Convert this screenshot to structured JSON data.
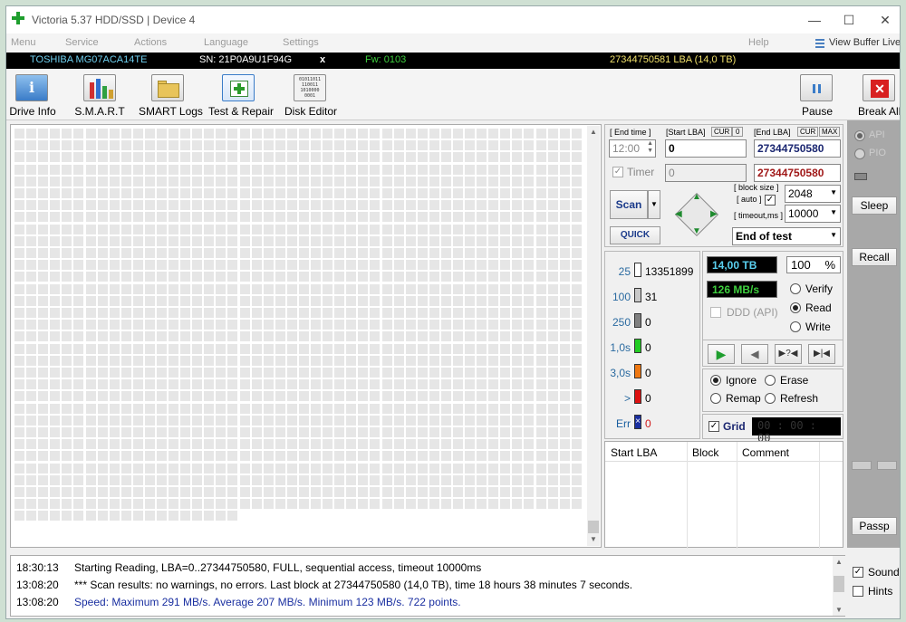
{
  "window": {
    "title": "Victoria 5.37 HDD/SSD | Device 4",
    "minimize": "—",
    "maximize": "☐",
    "close": "✕"
  },
  "menu": {
    "items": [
      "Menu",
      "Service",
      "Actions",
      "Language",
      "Settings"
    ],
    "help": "Help",
    "view_buffer": "View Buffer Live"
  },
  "drive": {
    "model": "TOSHIBA MG07ACA14TE",
    "serial": "SN: 21P0A9U1F94G",
    "x": "x",
    "fw": "Fw: 0103",
    "capacity": "27344750581 LBA (14,0 TB)"
  },
  "toolbar": {
    "drive_info": "Drive Info",
    "smart": "S.M.A.R.T",
    "smart_logs": "SMART Logs",
    "test_repair": "Test & Repair",
    "disk_editor": "Disk Editor",
    "pause": "Pause",
    "break_all": "Break All",
    "disk_editor_icon_text": "01011011\n110011\n1010000\n0001"
  },
  "scan_panel": {
    "end_time_label": "[ End time ]",
    "end_time_value": "12:00",
    "start_lba_label": "[Start LBA]",
    "cur": "CUR",
    "zero": "0",
    "start_lba_value": "0",
    "end_lba_label": "[End LBA]",
    "max": "MAX",
    "end_lba_value": "27344750580",
    "timer_label": "Timer",
    "timer_value": "0",
    "end_lba_value2": "27344750580",
    "scan_button": "Scan",
    "quick_button": "QUICK",
    "block_size_label": "[ block size ]",
    "auto_label": "[ auto ]",
    "block_size_value": "2048",
    "timeout_label": "[ timeout,ms ]",
    "timeout_value": "10000",
    "end_of_test": "End of test"
  },
  "stats": {
    "rows": [
      {
        "label": "25",
        "value": "13351899",
        "color": "#ffffff"
      },
      {
        "label": "100",
        "value": "31",
        "color": "#c8c8c8"
      },
      {
        "label": "250",
        "value": "0",
        "color": "#808080"
      },
      {
        "label": "1,0s",
        "value": "0",
        "color": "#22cc22"
      },
      {
        "label": "3,0s",
        "value": "0",
        "color": "#ee7711"
      },
      {
        "label": ">",
        "value": "0",
        "color": "#dd1111"
      },
      {
        "label": "Err",
        "value": "0",
        "color": "#1a2fa0"
      }
    ],
    "size_display": "14,00 TB",
    "speed_display": "126 MB/s",
    "percent_value": "100",
    "percent_sign": "%",
    "verify": "Verify",
    "read": "Read",
    "write": "Write",
    "ddd": "DDD (API)",
    "ignore": "Ignore",
    "erase": "Erase",
    "remap": "Remap",
    "refresh": "Refresh",
    "grid": "Grid",
    "timer_display": "00 : 00 : 00"
  },
  "defects_table": {
    "columns": [
      "Start LBA",
      "Block",
      "Comment"
    ]
  },
  "right_panel": {
    "api": "API",
    "pio": "PIO",
    "sleep": "Sleep",
    "recall": "Recall",
    "passp": "Passp",
    "sound": "Sound",
    "hints": "Hints"
  },
  "log": [
    {
      "time": "18:30:13",
      "text": "Starting Reading, LBA=0..27344750580, FULL, sequential access, timeout 10000ms",
      "color": "#000000"
    },
    {
      "time": "13:08:20",
      "text": "*** Scan results: no warnings, no errors. Last block at 27344750580 (14,0 TB), time 18 hours 38 minutes 7 seconds.",
      "color": "#000000"
    },
    {
      "time": "13:08:20",
      "text": "Speed: Maximum 291 MB/s. Average 207 MB/s. Minimum 123 MB/s. 722 points.",
      "color": "#1a2fa0"
    }
  ],
  "map_progress": {
    "rows": 33,
    "cols": 48,
    "last_row_filled": 19
  }
}
